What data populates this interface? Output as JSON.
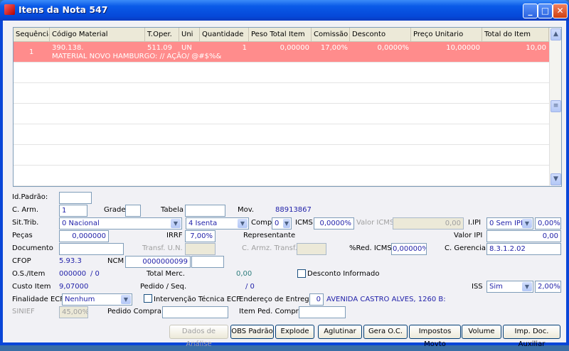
{
  "window": {
    "title": "Itens da Nota 547",
    "minimize": "_",
    "maximize": "□",
    "close": "✕"
  },
  "grid": {
    "columns": [
      "Sequência",
      "Código Material",
      "T.Oper.",
      "Uni",
      "Quantidade",
      "Peso Total Item",
      "Comissão",
      "Desconto",
      "Preço Unitario",
      "Total do Item"
    ],
    "rows": [
      {
        "seq": "1",
        "codigo": "390.138.",
        "descricao": "MATERIAL NOVO HAMBURGO: // AÇÃO/ @#$%&",
        "toper": "511.09",
        "uni": "UN",
        "quantidade": "1",
        "peso": "0,00000",
        "comissao": "17,00%",
        "desconto": "0,0000%",
        "preco": "10,00000",
        "total": "10,00"
      }
    ],
    "row_highlight": "#ff8c8c"
  },
  "form": {
    "id_padrao_label": "Id.Padrão:",
    "id_padrao": "",
    "c_arm_label": "C. Arm.",
    "c_arm": "1",
    "grade_label": "Grade",
    "grade": "",
    "tabela_label": "Tabela",
    "tabela": "",
    "mov_label": "Mov.",
    "mov": "88913867",
    "sit_trib_label": "Sit.Trib.",
    "sit_trib": "0 Nacional",
    "sit_trib2": "4 Isenta",
    "compl_label": "Compl",
    "compl": "0",
    "icms_label": "ICMS",
    "icms": "0,0000%",
    "valor_icms_label": "Valor ICMS",
    "valor_icms": "0,00",
    "ipi_label": "I.IPI",
    "ipi": "0 Sem IPI",
    "ipi_pct": "0,00%",
    "pecas_label": "Peças",
    "pecas": "0,000000",
    "irrf_label": "IRRF",
    "irrf": "7,00%",
    "representante_label": "Representante",
    "valor_ipi_label": "Valor IPI",
    "valor_ipi": "0,00",
    "documento_label": "Documento",
    "documento": "",
    "transf_un_label": "Transf. U.N.",
    "c_armz_transf_label": "C. Armz. Transf.",
    "red_icms_label": "%Red. ICMS",
    "red_icms": "0,00000%",
    "c_gerencial_label": "C. Gerencial",
    "c_gerencial": "8.3.1.2.02",
    "cfop_label": "CFOP",
    "cfop": "5.93.3",
    "ncm_label": "NCM",
    "ncm": "0000000099",
    "ncm2": "",
    "os_item_label": "O.S./Item",
    "os": "000000",
    "os_item": "/ 0",
    "total_merc_label": "Total Merc.",
    "total_merc": "0,00",
    "desconto_informado_label": "Desconto Informado",
    "custo_item_label": "Custo Item",
    "custo_item": "9,07000",
    "pedido_seq_label": "Pedido / Seq.",
    "pedido_seq": "/ 0",
    "iss_label": "ISS",
    "iss": "Sim",
    "iss_pct": "2,00%",
    "finalidade_label": "Finalidade ECF",
    "finalidade": "Nenhum",
    "intervencao_label": "Intervenção Técnica ECF",
    "endereco_label": "Endereço de Entrega",
    "endereco_num": "0",
    "endereco": "AVENIDA CASTRO ALVES, 1260 B:",
    "sinief_label": "SINIEF",
    "sinief": "45,00%",
    "pedido_compra_label": "Pedido Compra",
    "pedido_compra": "",
    "item_ped_compra_label": "Item Ped. Compra",
    "item_ped_compra": ""
  },
  "buttons": [
    "Dados de Análise",
    "OBS Padrão",
    "Explode",
    "Aglutinar",
    "Gera O.C.",
    "Impostos Movto",
    "Volume",
    "Imp. Doc. Auxiliar"
  ]
}
